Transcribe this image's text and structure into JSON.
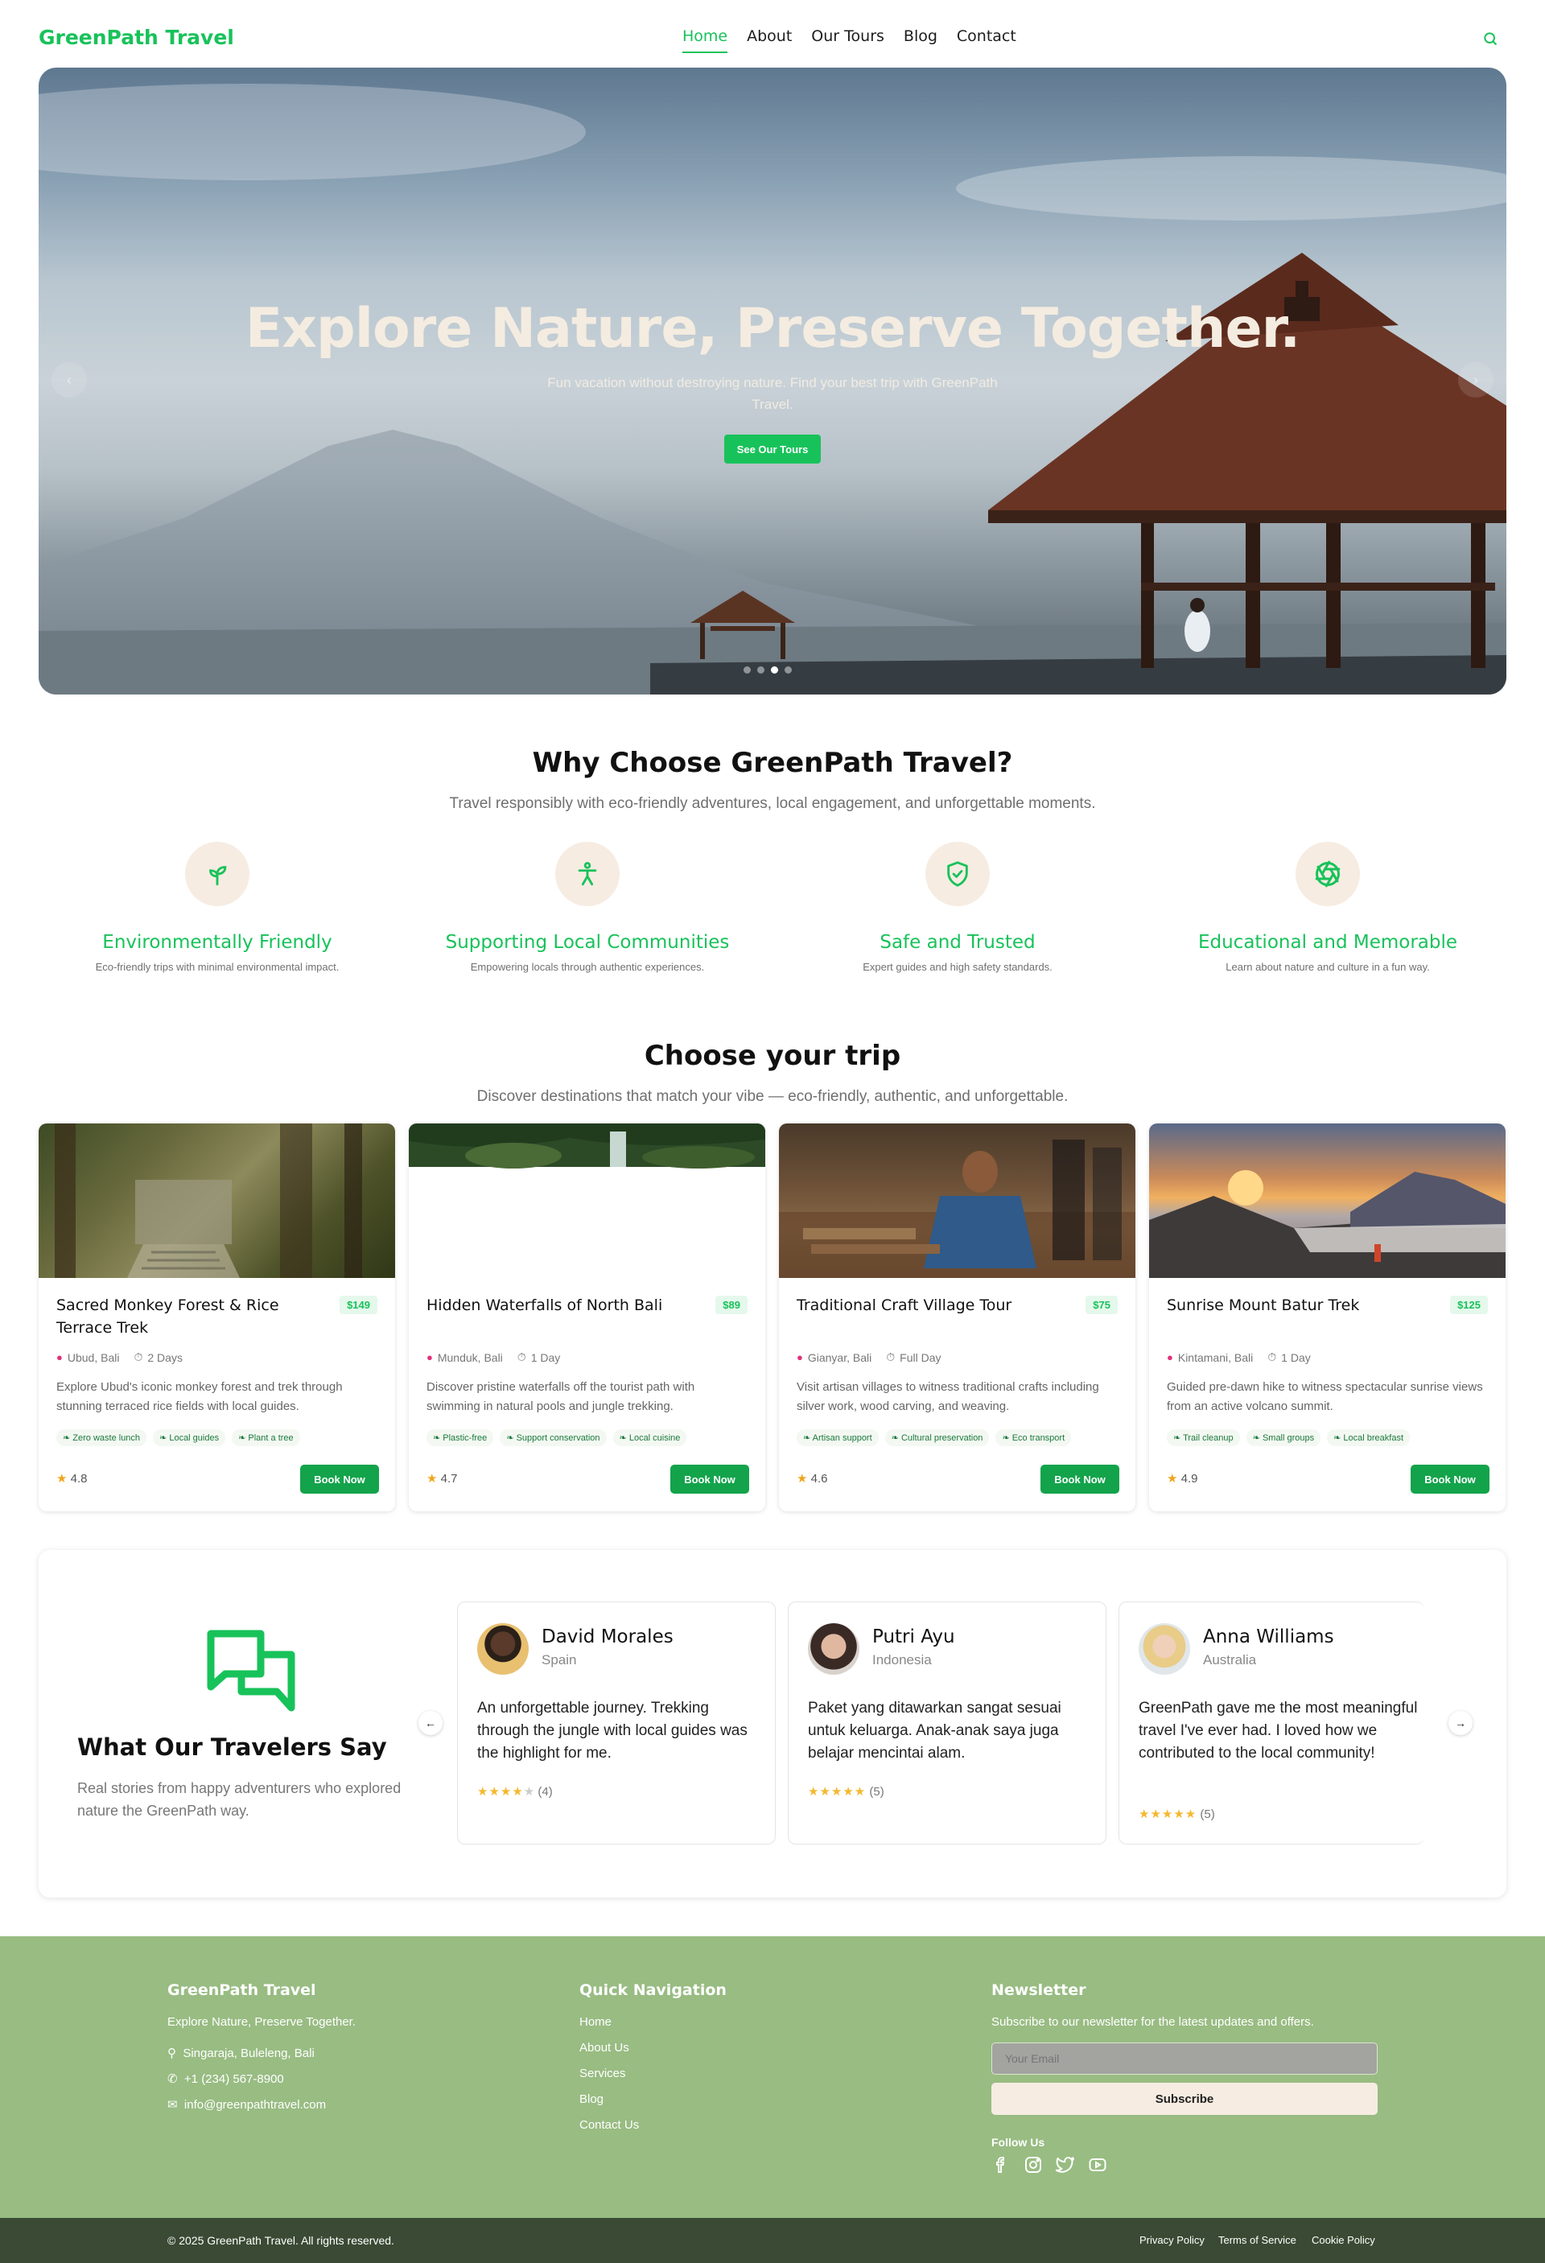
{
  "header": {
    "logo": "GreenPath Travel",
    "nav": [
      "Home",
      "About",
      "Our Tours",
      "Blog",
      "Contact"
    ],
    "active": "Home",
    "search_icon": "search-icon"
  },
  "hero": {
    "title": "Explore Nature, Preserve Together.",
    "subtitle": "Fun vacation without destroying nature. Find your best trip with GreenPath Travel.",
    "cta": "See Our Tours",
    "prev_icon": "chevron-left-icon",
    "next_icon": "chevron-right-icon",
    "slides": 4,
    "active_slide": 3
  },
  "why": {
    "title": "Why Choose GreenPath Travel?",
    "subtitle": "Travel responsibly with eco-friendly adventures, local engagement, and unforgettable moments.",
    "features": [
      {
        "icon": "sprout-icon",
        "title": "Environmentally Friendly",
        "desc": "Eco-friendly trips with minimal environmental impact."
      },
      {
        "icon": "person-icon",
        "title": "Supporting Local Communities",
        "desc": "Empowering locals through authentic experiences."
      },
      {
        "icon": "shield-check-icon",
        "title": "Safe and Trusted",
        "desc": "Expert guides and high safety standards."
      },
      {
        "icon": "aperture-icon",
        "title": "Educational and Memorable",
        "desc": "Learn about nature and culture in a fun way."
      }
    ]
  },
  "trips": {
    "title": "Choose your trip",
    "subtitle": "Discover destinations that match your vibe — eco-friendly, authentic, and unforgettable.",
    "cards": [
      {
        "title": "Sacred Monkey Forest & Rice Terrace Trek",
        "price": "$149",
        "location": "Ubud, Bali",
        "duration": "2 Days",
        "desc": "Explore Ubud's iconic monkey forest and trek through stunning terraced rice fields with local guides.",
        "tags": [
          "Zero waste lunch",
          "Local guides",
          "Plant a tree"
        ],
        "rating": "4.8",
        "cta": "Book Now"
      },
      {
        "title": "Hidden Waterfalls of North Bali",
        "price": "$89",
        "location": "Munduk, Bali",
        "duration": "1 Day",
        "desc": "Discover pristine waterfalls off the tourist path with swimming in natural pools and jungle trekking.",
        "tags": [
          "Plastic-free",
          "Support conservation",
          "Local cuisine"
        ],
        "rating": "4.7",
        "cta": "Book Now"
      },
      {
        "title": "Traditional Craft Village Tour",
        "price": "$75",
        "location": "Gianyar, Bali",
        "duration": "Full Day",
        "desc": "Visit artisan villages to witness traditional crafts including silver work, wood carving, and weaving.",
        "tags": [
          "Artisan support",
          "Cultural preservation",
          "Eco transport"
        ],
        "rating": "4.6",
        "cta": "Book Now"
      },
      {
        "title": "Sunrise Mount Batur Trek",
        "price": "$125",
        "location": "Kintamani, Bali",
        "duration": "1 Day",
        "desc": "Guided pre-dawn hike to witness spectacular sunrise views from an active volcano summit.",
        "tags": [
          "Trail cleanup",
          "Small groups",
          "Local breakfast"
        ],
        "rating": "4.9",
        "cta": "Book Now"
      }
    ]
  },
  "testimonials": {
    "title": "What Our Travelers Say",
    "subtitle": "Real stories from happy adventurers who explored nature the GreenPath way.",
    "icon": "chat-bubbles-icon",
    "items": [
      {
        "name": "David Morales",
        "country": "Spain",
        "quote": "An unforgettable journey. Trekking through the jungle with local guides was the highlight for me.",
        "stars": 4,
        "count": "(4)"
      },
      {
        "name": "Putri Ayu",
        "country": "Indonesia",
        "quote": "Paket yang ditawarkan sangat sesuai untuk keluarga. Anak-anak saya juga belajar mencintai alam.",
        "stars": 5,
        "count": "(5)"
      },
      {
        "name": "Anna Williams",
        "country": "Australia",
        "quote": "GreenPath gave me the most meaningful travel I've ever had. I loved how we contributed to the local community!",
        "stars": 5,
        "count": "(5)"
      }
    ]
  },
  "footer": {
    "brand": "GreenPath Travel",
    "tagline": "Explore Nature, Preserve Together.",
    "address": "Singaraja, Buleleng, Bali",
    "phone": "+1 (234) 567-8900",
    "email": "info@greenpathtravel.com",
    "nav_title": "Quick Navigation",
    "nav_links": [
      "Home",
      "About Us",
      "Services",
      "Blog",
      "Contact Us"
    ],
    "newsletter_title": "Newsletter",
    "newsletter_text": "Subscribe to our newsletter for the latest updates and offers.",
    "email_placeholder": "Your Email",
    "subscribe": "Subscribe",
    "follow": "Follow Us",
    "social": [
      "facebook-icon",
      "instagram-icon",
      "twitter-icon",
      "youtube-icon"
    ],
    "copyright": "© 2025 GreenPath Travel. All rights reserved.",
    "legal": [
      "Privacy Policy",
      "Terms of Service",
      "Cookie Policy"
    ]
  },
  "colors": {
    "brand": "#18c25a",
    "footer": "#98bc82",
    "footer_bottom": "#3a4a34",
    "accent_cream": "#f6ece2"
  }
}
